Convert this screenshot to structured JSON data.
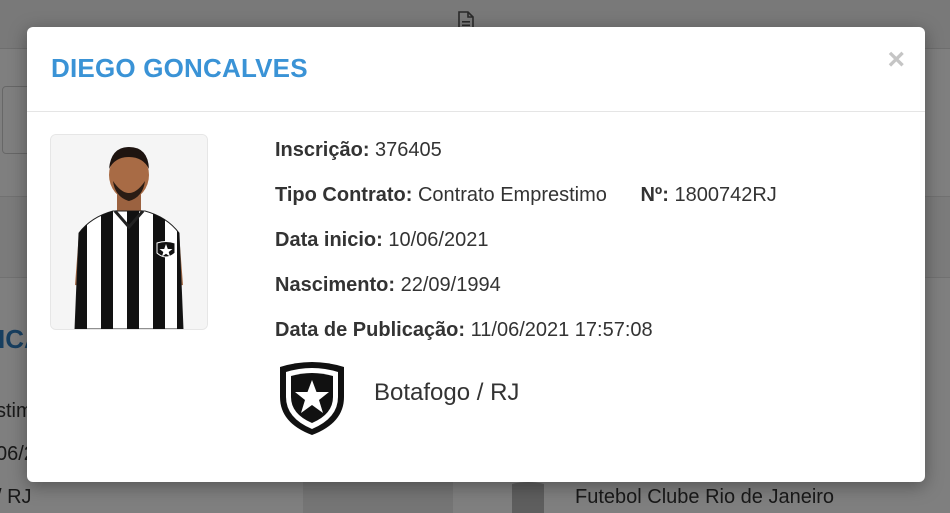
{
  "background": {
    "heading_fragment": "ICA",
    "line1": "stim",
    "line2": "06/2",
    "line3": "/ RJ",
    "line4": "Futebol Clube Rio de Janeiro"
  },
  "modal": {
    "title": "DIEGO GONCALVES",
    "close_label": "×",
    "fields": {
      "inscricao_label": "Inscrição:",
      "inscricao_value": "376405",
      "tipo_contrato_label": "Tipo Contrato:",
      "tipo_contrato_value": "Contrato Emprestimo",
      "numero_label": "Nº:",
      "numero_value": "1800742RJ",
      "data_inicio_label": "Data inicio:",
      "data_inicio_value": "10/06/2021",
      "nascimento_label": "Nascimento:",
      "nascimento_value": "22/09/1994",
      "publicacao_label": "Data de Publicação:",
      "publicacao_value": "11/06/2021 17:57:08"
    },
    "club": {
      "name": "Botafogo / RJ",
      "crest_icon": "botafogo-crest-icon"
    }
  },
  "colors": {
    "title": "#3a93d6",
    "overlay": "rgba(0,0,0,0.5)",
    "text": "#333333"
  }
}
